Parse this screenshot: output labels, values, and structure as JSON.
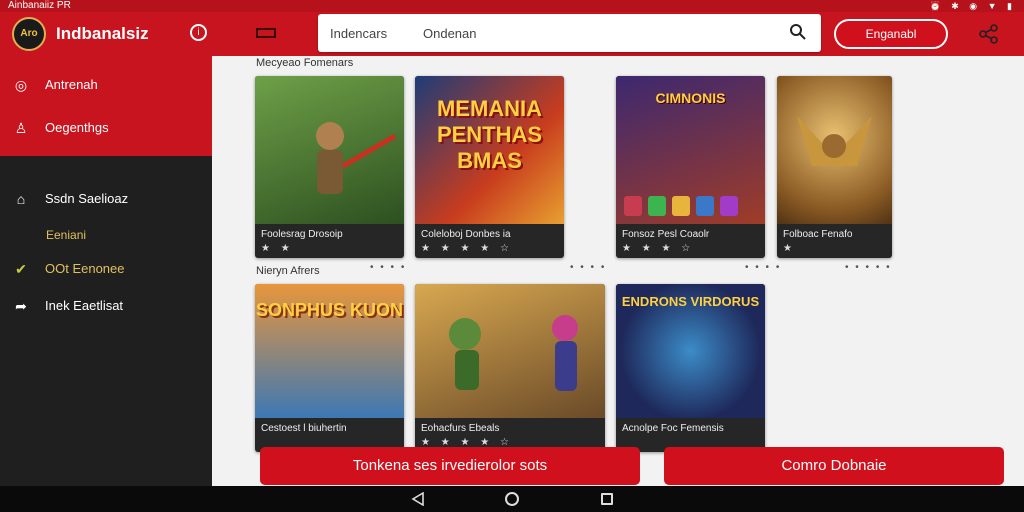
{
  "status_bar": {
    "left_text": "Ainbanaiiz  PR",
    "right_icons": "alarm bluetooth wifi signal battery"
  },
  "header": {
    "app_title": "Indbanalsiz",
    "logo_text": "Aro",
    "search": {
      "tab_left": "Indencars",
      "tab_right": "Ondenan"
    },
    "action_button": "Enganabl"
  },
  "sidebar": {
    "items": [
      {
        "label": "Antrenah",
        "icon": "target-icon"
      },
      {
        "label": "Oegenthgs",
        "icon": "user-icon"
      },
      {
        "label": "Ssdn Saelioaz",
        "icon": "home-icon"
      },
      {
        "label": "OOt Eenonee",
        "icon": "check-icon"
      },
      {
        "label": "Inek Eaetlisat",
        "icon": "share-icon"
      }
    ],
    "sub_label": "Eeniani"
  },
  "sections": [
    {
      "title": "Mecyeao Fomenars",
      "cards": [
        {
          "caption": "Foolesrag Drosoip",
          "stars": "★ ★",
          "art_text": "",
          "colors": [
            "#5a8a3a",
            "#2d5020"
          ]
        },
        {
          "caption": "Coleloboj Donbes ia",
          "stars": "★ ★ ★ ★ ☆",
          "art_text": "MEMANIA PENTHAS BMAS",
          "colors": [
            "#c83c1e",
            "#1e3c78"
          ]
        },
        {
          "caption": "Fonsoz Pesl Coaolr",
          "stars": "★ ★ ★ ☆",
          "art_text": "CIMNONIS",
          "colors": [
            "#3c2870",
            "#a03c28"
          ]
        },
        {
          "caption": "Folboac Fenafo",
          "stars": "★",
          "art_text": "",
          "colors": [
            "#c8963c",
            "#503214"
          ]
        }
      ]
    },
    {
      "title": "Nieryn Afrers",
      "cards": [
        {
          "caption": "Cestoest l biuhertin",
          "stars": "",
          "art_text": "SONPHUS KUON",
          "colors": [
            "#e8963c",
            "#3c78b4"
          ]
        },
        {
          "caption": "Eohacfurs Ebeals",
          "stars": "★ ★ ★ ★ ☆",
          "art_text": "",
          "colors": [
            "#d8a850",
            "#6a4a28"
          ]
        },
        {
          "caption": "Acnolpe Foc Femensis",
          "stars": "",
          "art_text": "ENDRONS VIRDORUS",
          "colors": [
            "#1e285a",
            "#3c8cc8"
          ]
        }
      ]
    }
  ],
  "buttons": {
    "primary": "Tonkena ses irvedierolor sots",
    "secondary": "Comro Dobnaie"
  }
}
